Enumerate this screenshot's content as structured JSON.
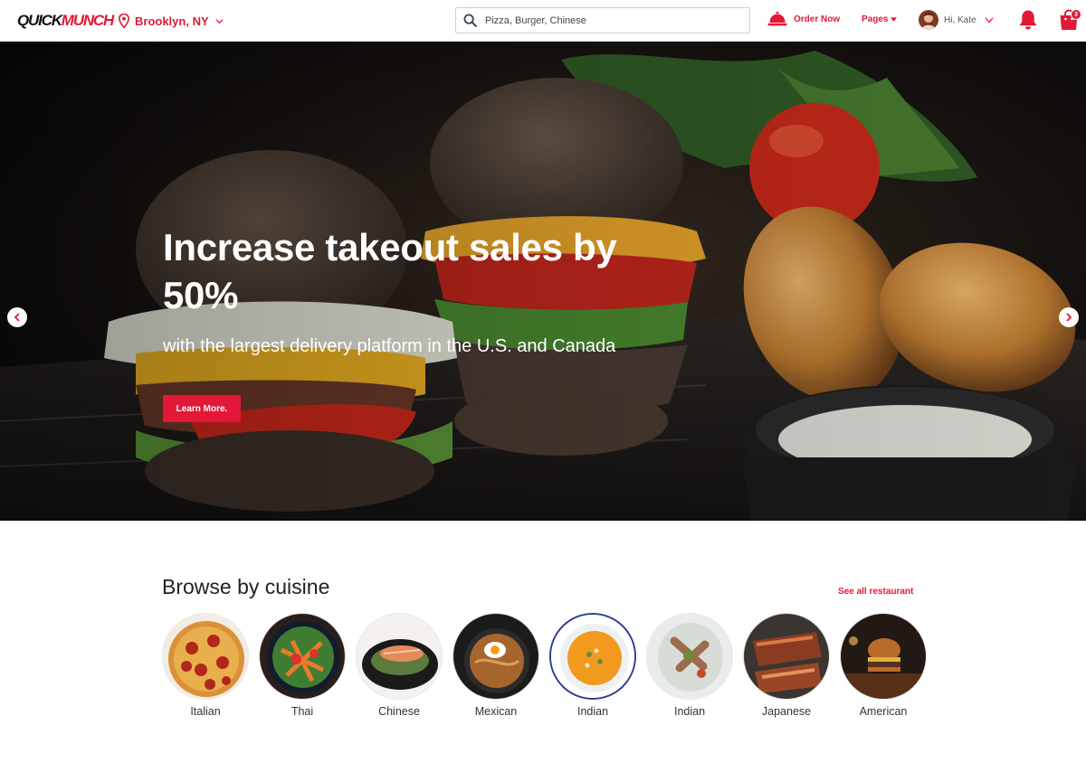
{
  "brand": {
    "logo_left": "QUICK",
    "logo_right": "MUNCH",
    "accent": "#e31837"
  },
  "header": {
    "location": "Brooklyn, NY",
    "search_placeholder": "Pizza, Burger, Chinese",
    "order_now": "Order Now",
    "pages": "Pages",
    "greeting": "Hi, Kate",
    "cart_count": "3",
    "icons": [
      "location-pin-icon",
      "search-icon",
      "service-bell-icon",
      "bell-icon",
      "shopping-bag-icon"
    ]
  },
  "hero": {
    "title": "Increase takeout sales by 50%",
    "subtitle": "with the largest delivery platform in the U.S. and Canada",
    "cta": "Learn More."
  },
  "browse": {
    "title": "Browse by cuisine",
    "see_all": "See all restaurant",
    "items": [
      {
        "label": "Italian"
      },
      {
        "label": "Thai"
      },
      {
        "label": "Chinese"
      },
      {
        "label": "Mexican"
      },
      {
        "label": "Indian"
      },
      {
        "label": "Indian"
      },
      {
        "label": "Japanese"
      },
      {
        "label": "American"
      }
    ]
  }
}
